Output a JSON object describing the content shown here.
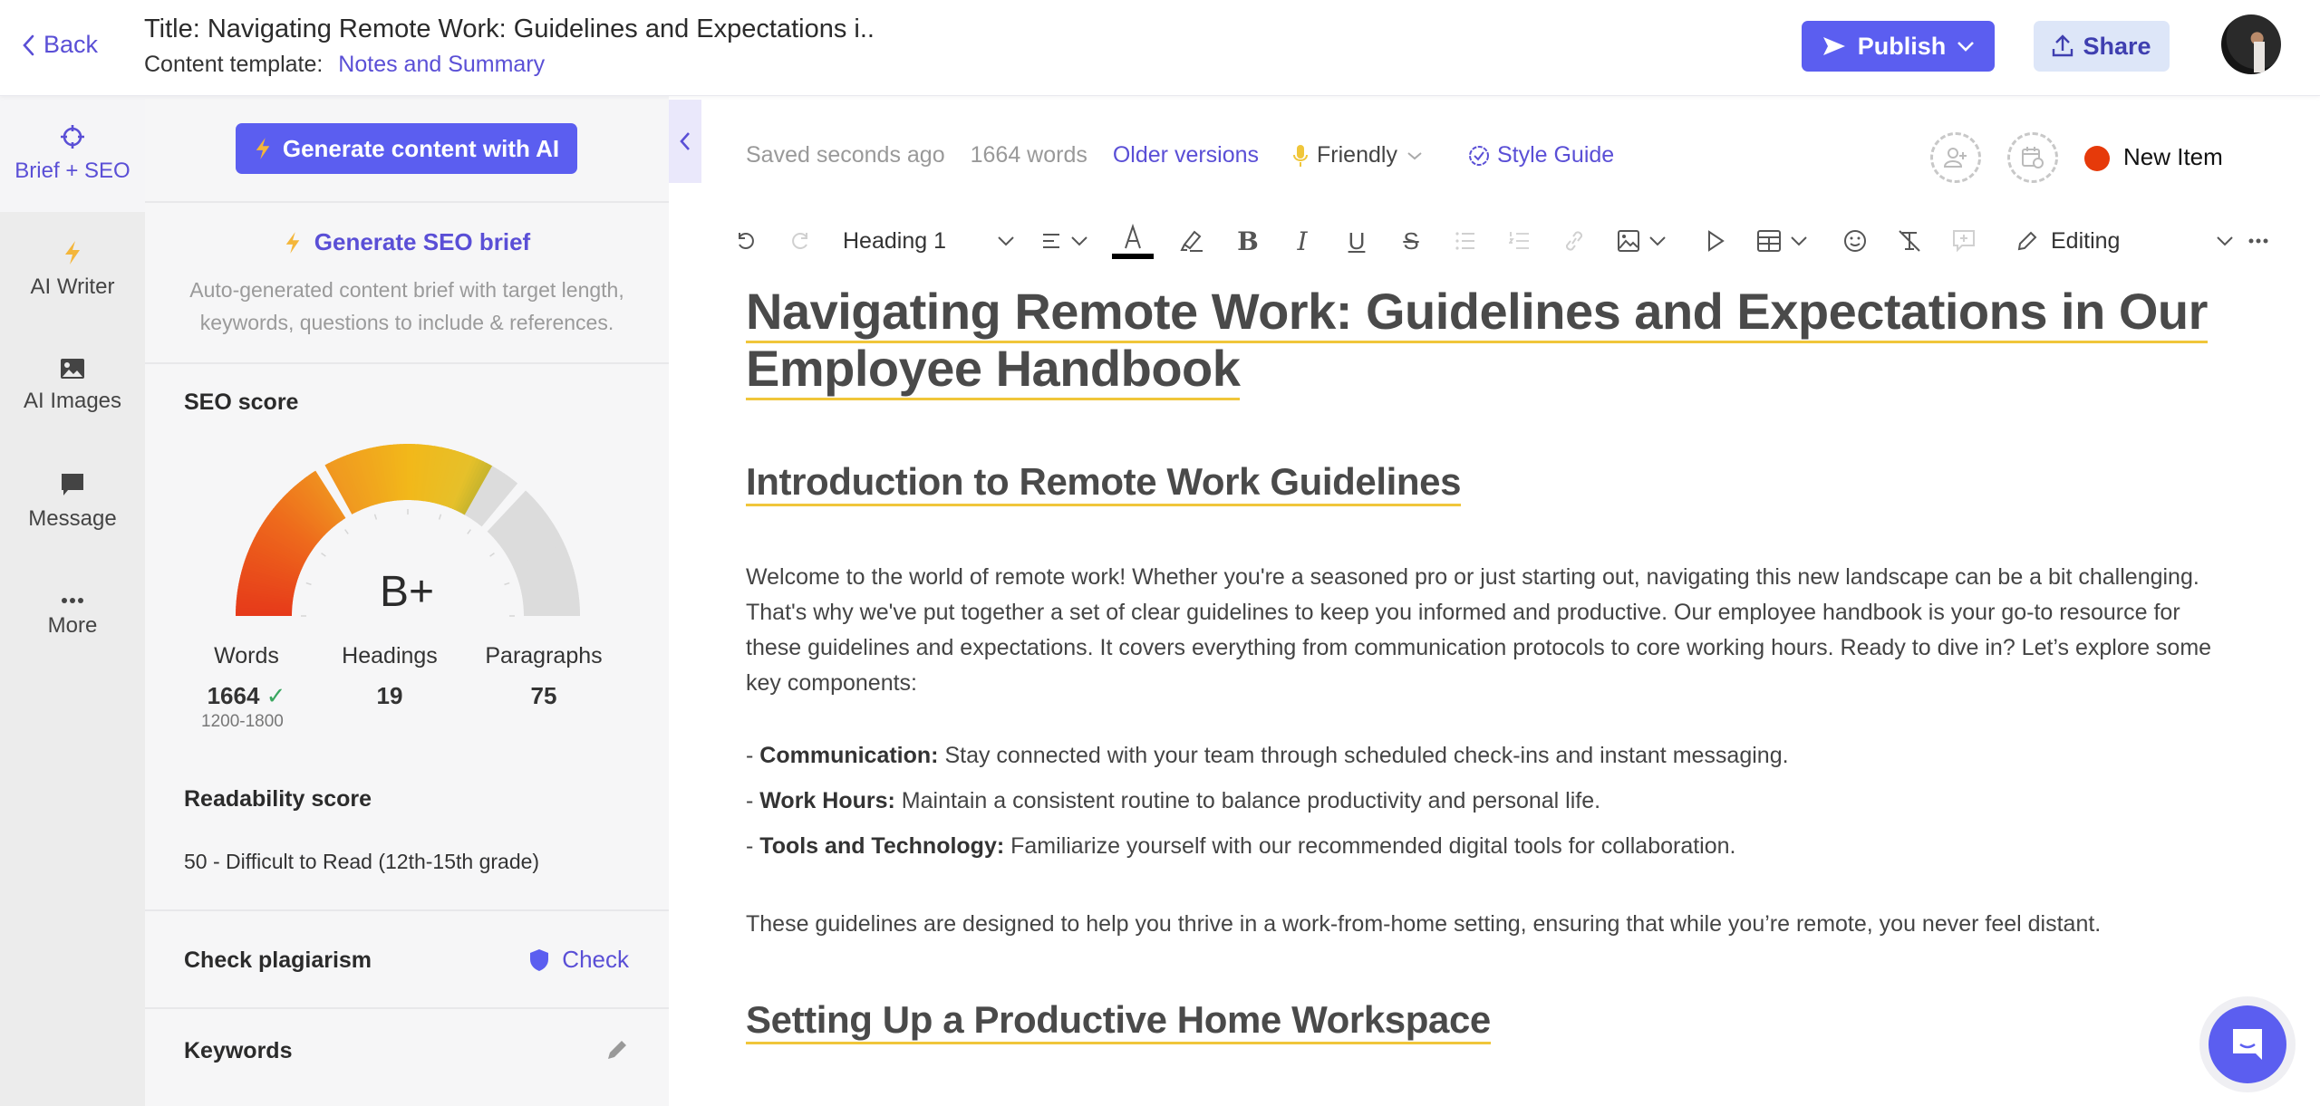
{
  "header": {
    "back_label": "Back",
    "title": "Title: Navigating Remote Work: Guidelines and Expectations i..",
    "template_label": "Content template:",
    "template_value": "Notes and Summary",
    "publish_label": "Publish",
    "share_label": "Share"
  },
  "rail": {
    "items": [
      {
        "label": "Brief + SEO",
        "icon": "target-icon",
        "active": true
      },
      {
        "label": "AI Writer",
        "icon": "lightning-icon"
      },
      {
        "label": "AI Images",
        "icon": "image-icon"
      },
      {
        "label": "Message",
        "icon": "message-icon"
      },
      {
        "label": "More",
        "icon": "more-dots-icon"
      }
    ]
  },
  "panel": {
    "generate_ai_label": "Generate content with AI",
    "seo_brief_label": "Generate SEO brief",
    "seo_brief_desc_1": "Auto-generated content brief with target length,",
    "seo_brief_desc_2": "keywords, questions to include & references.",
    "seo_score_label": "SEO score",
    "seo_grade": "B+",
    "seo_score_fraction": 0.66,
    "stats": {
      "words_label": "Words",
      "words_value": "1664",
      "words_range": "1200-1800",
      "headings_label": "Headings",
      "headings_value": "19",
      "paragraphs_label": "Paragraphs",
      "paragraphs_value": "75"
    },
    "readability_label": "Readability score",
    "readability_value": "50 - Difficult to Read (12th-15th grade)",
    "plagiarism_label": "Check plagiarism",
    "plagiarism_button": "Check",
    "keywords_label": "Keywords"
  },
  "editor": {
    "saved_status": "Saved seconds ago",
    "word_count": "1664 words",
    "older_versions": "Older versions",
    "tone": "Friendly",
    "style_guide": "Style Guide",
    "status_label": "New Item",
    "status_color": "#e63a0a",
    "toolbar": {
      "block_type": "Heading 1",
      "mode": "Editing"
    }
  },
  "document": {
    "title": "Navigating Remote Work: Guidelines and Expectations in Our Employee Handbook",
    "section1_heading": "Introduction to Remote Work Guidelines",
    "intro_paragraph": "Welcome to the world of remote work! Whether you're a seasoned pro or just starting out, navigating this new landscape can be a bit challenging. That's why we've put together a set of clear guidelines to keep you informed and productive. Our employee handbook is your go-to resource for these guidelines and expectations. It covers everything from communication protocols to core working hours. Ready to dive in? Let’s explore some key components:",
    "bullets": [
      {
        "term": "Communication:",
        "text": " Stay connected with your team through scheduled check-ins and instant messaging."
      },
      {
        "term": "Work Hours:",
        "text": " Maintain a consistent routine to balance productivity and personal life."
      },
      {
        "term": "Tools and Technology:",
        "text": " Familiarize yourself with our recommended digital tools for collaboration."
      }
    ],
    "closing_paragraph": "These guidelines are designed to help you thrive in a work-from-home setting, ensuring that while you’re remote, you never feel distant.",
    "section2_heading": "Setting Up a Productive Home Workspace"
  },
  "colors": {
    "accent": "#5b5ef0",
    "link": "#5a4fd6",
    "heading_underline": "#f0c63a"
  }
}
